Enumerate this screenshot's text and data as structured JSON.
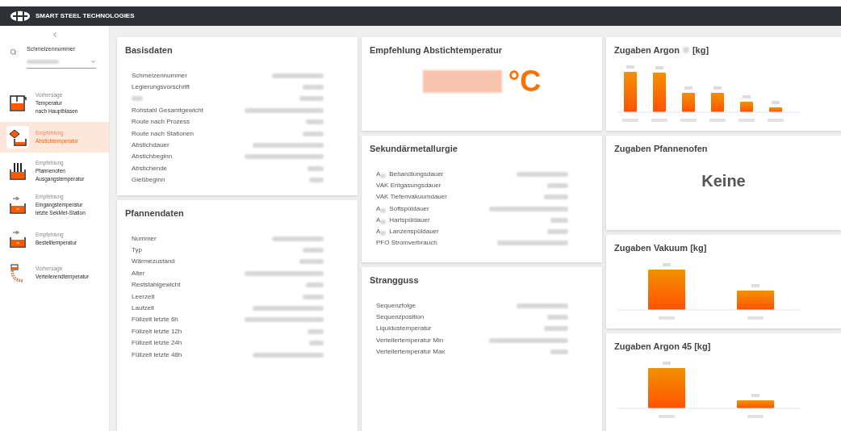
{
  "header": {
    "brand": "SMART STEEL TECHNOLOGIES"
  },
  "sidebar": {
    "search_label": "Schmelzennummer",
    "items": [
      {
        "kind": "predict",
        "caption": "Vorhersage",
        "lines": [
          "Temperatur",
          "nach Hauptblasen"
        ],
        "selected": false
      },
      {
        "kind": "tap",
        "caption": "Empfehlung",
        "lines": [
          "Abstichtemperatur"
        ],
        "selected": true
      },
      {
        "kind": "furnace",
        "caption": "Empfehlung",
        "lines": [
          "Pfannenofen",
          "Ausgangstemperatur"
        ],
        "selected": false
      },
      {
        "kind": "ladle",
        "caption": "Empfehlung",
        "lines": [
          "Eingangstemperatur",
          "letzte SekMet-Station"
        ],
        "selected": false
      },
      {
        "kind": "ladle",
        "caption": "Empfehlung",
        "lines": [
          "Bestelltemperatur"
        ],
        "selected": false
      },
      {
        "kind": "tundish",
        "caption": "Vorhersage",
        "lines": [
          "Verteilerendtemperatur"
        ],
        "selected": false
      }
    ]
  },
  "basisdaten": {
    "title": "Basisdaten",
    "rows": [
      {
        "label": "Schmelzennummer"
      },
      {
        "label": "Legierungsvorschrift"
      },
      {
        "label": ""
      },
      {
        "label": "Rohstahl Gesamtgewicht"
      },
      {
        "label": "Route nach Prozess"
      },
      {
        "label": "Route nach Stationen"
      },
      {
        "label": "Abstichdauer"
      },
      {
        "label": "Abstichbeginn"
      },
      {
        "label": "Abstichende"
      },
      {
        "label": "Gießbeginn"
      }
    ]
  },
  "pfannendaten": {
    "title": "Pfannendaten",
    "rows": [
      {
        "label": "Nummer"
      },
      {
        "label": "Typ"
      },
      {
        "label": "Wärmezustand"
      },
      {
        "label": "Alter"
      },
      {
        "label": "Reststahlgewicht"
      },
      {
        "label": "Leerzeit"
      },
      {
        "label": "Laufzeit"
      },
      {
        "label": "Füllzeit letzte 6h"
      },
      {
        "label": "Füllzeit letzte 12h"
      },
      {
        "label": "Füllzeit letzte 24h"
      },
      {
        "label": "Füllzeit letzte 48h"
      }
    ]
  },
  "empfehlung": {
    "title": "Empfehlung Abstichtemperatur",
    "unit": "°C"
  },
  "sekundaer": {
    "title": "Sekundärmetallurgie",
    "rows": [
      {
        "prefix": "A",
        "label": "Behandlungsdauer"
      },
      {
        "label": "VAK Entgasungsdauer"
      },
      {
        "label": "VAK Tiefenvakuumdauer"
      },
      {
        "prefix": "A",
        "label": "Softspüldauer"
      },
      {
        "prefix": "A",
        "label": "Hartspüldauer"
      },
      {
        "prefix": "A",
        "label": "Lanzenspüldauer"
      },
      {
        "label": "PFO Stromverbrauch"
      }
    ]
  },
  "strangguss": {
    "title": "Strangguss",
    "rows": [
      {
        "label": "Sequenzfolge"
      },
      {
        "label": "Sequenzposition"
      },
      {
        "label": "Liquidustemperatur"
      },
      {
        "label": "Verteilertemperatur Min"
      },
      {
        "label": "Verteilertemperatur Max"
      }
    ]
  },
  "argon": {
    "title": "Zugaben Argon",
    "title_suffix": "[kg]"
  },
  "pfannenofen": {
    "title": "Zugaben Pfannenofen",
    "empty_text": "Keine"
  },
  "vakuum": {
    "title": "Zugaben Vakuum [kg]"
  },
  "argon45": {
    "title": "Zugaben Argon 45 [kg]"
  }
}
